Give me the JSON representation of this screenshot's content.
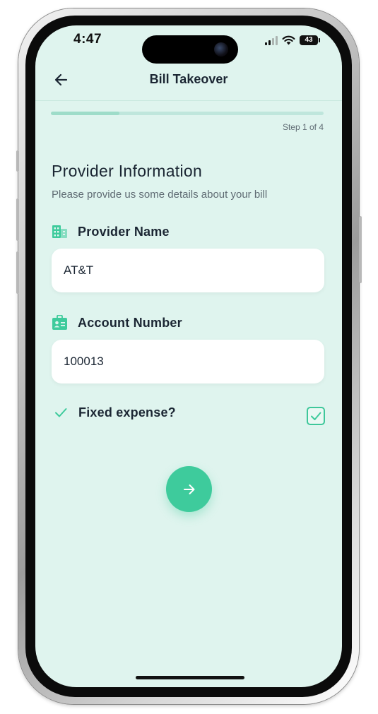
{
  "status_bar": {
    "time": "4:47",
    "battery_level": "43",
    "icons": [
      "signal-icon",
      "wifi-icon",
      "battery-icon"
    ]
  },
  "header": {
    "title": "Bill Takeover",
    "back_icon": "arrow-left-icon"
  },
  "progress": {
    "step_label": "Step 1 of 4",
    "fraction": 0.25
  },
  "form": {
    "title": "Provider Information",
    "subtitle": "Please provide us some details about your bill",
    "provider": {
      "label": "Provider Name",
      "icon": "building-icon",
      "value": "AT&T"
    },
    "account": {
      "label": "Account Number",
      "icon": "id-badge-icon",
      "value": "100013"
    },
    "fixed_expense": {
      "label": "Fixed expense?",
      "icon": "check-icon",
      "checked": true
    }
  },
  "next_button": {
    "icon": "arrow-right-icon"
  },
  "colors": {
    "background": "#dff4ee",
    "accent": "#3ecb9c",
    "text_primary": "#1b2633",
    "text_secondary": "#5f6b73"
  }
}
